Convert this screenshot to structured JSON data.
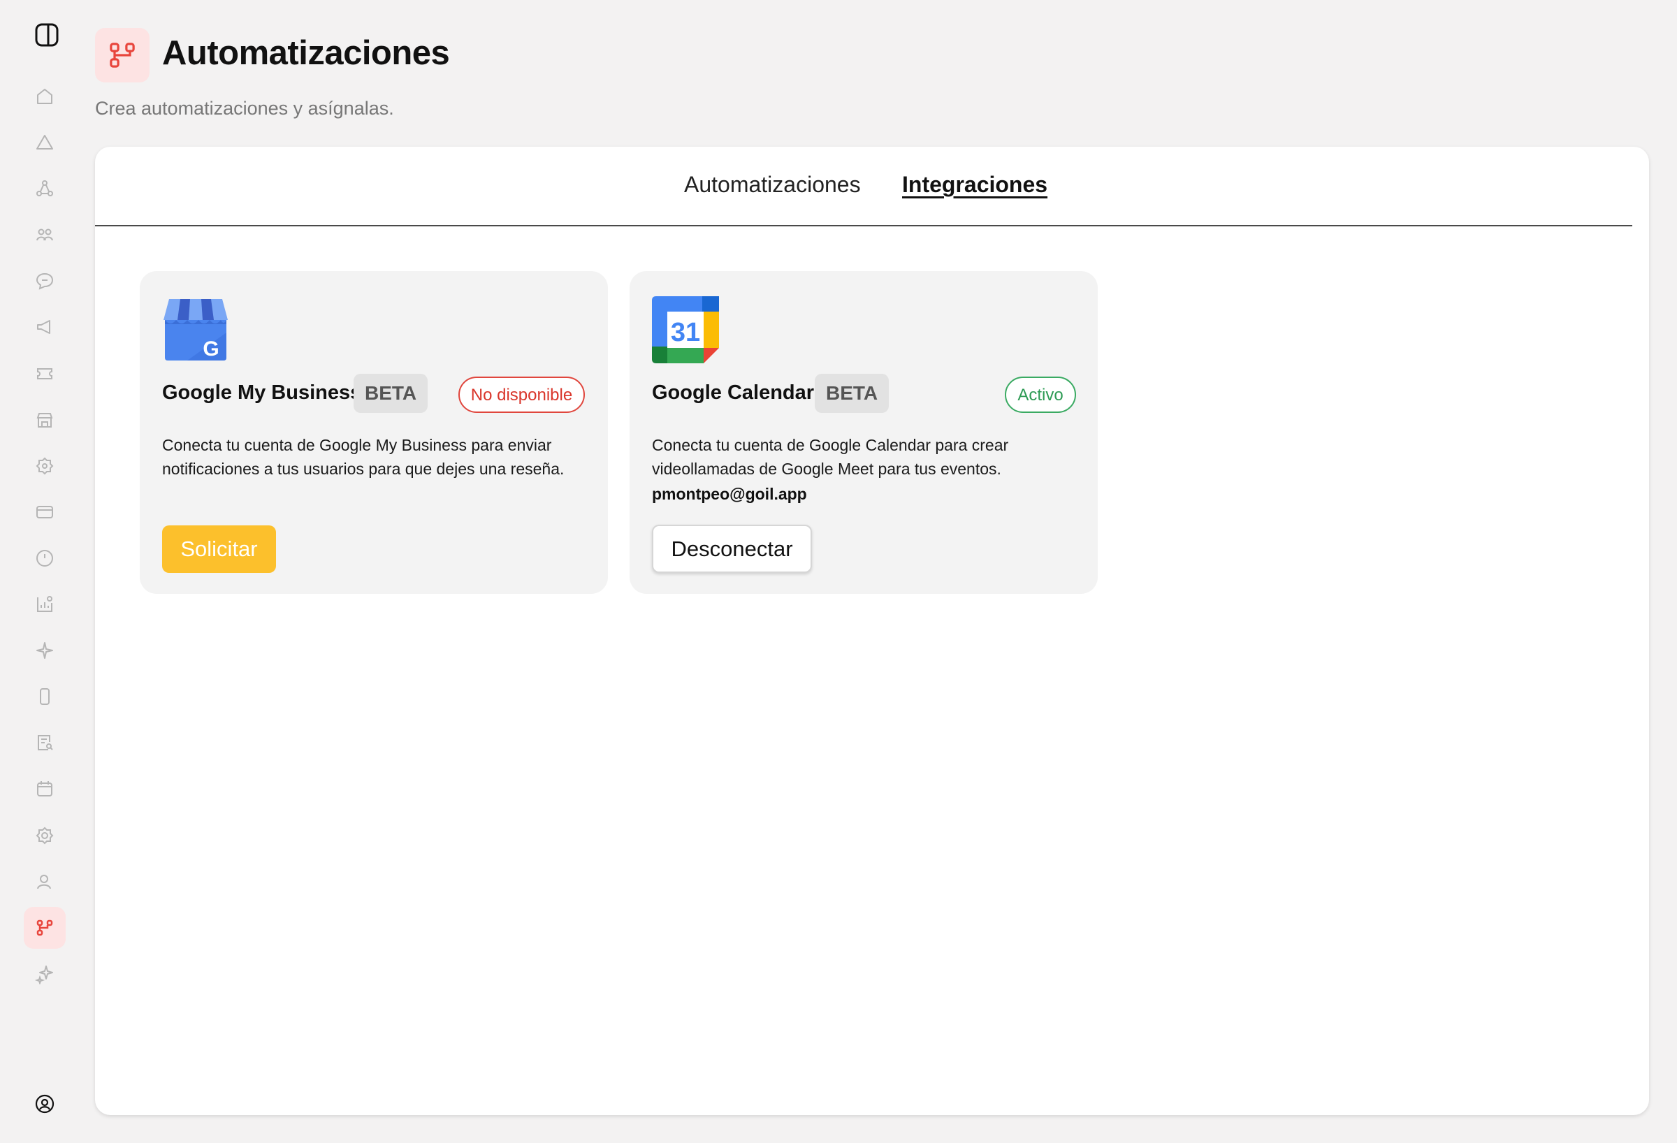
{
  "header": {
    "title": "Automatizaciones",
    "subtitle": "Crea automatizaciones y asígnalas."
  },
  "sidebar": {
    "items": [
      {
        "icon": "home-icon"
      },
      {
        "icon": "alert-triangle-icon"
      },
      {
        "icon": "network-icon"
      },
      {
        "icon": "users-icon"
      },
      {
        "icon": "chat-icon"
      },
      {
        "icon": "megaphone-icon"
      },
      {
        "icon": "ticket-icon"
      },
      {
        "icon": "store-icon"
      },
      {
        "icon": "settings-badge-icon"
      },
      {
        "icon": "card-icon"
      },
      {
        "icon": "clock-icon"
      },
      {
        "icon": "analytics-icon"
      },
      {
        "icon": "sparkle-icon"
      },
      {
        "icon": "phone-icon"
      },
      {
        "icon": "document-search-icon"
      },
      {
        "icon": "calendar-icon"
      },
      {
        "icon": "gear-icon"
      },
      {
        "icon": "user-icon"
      },
      {
        "icon": "automation-icon",
        "active": true
      },
      {
        "icon": "sparkles-icon"
      }
    ]
  },
  "tabs": [
    {
      "label": "Automatizaciones",
      "active": false
    },
    {
      "label": "Integraciones",
      "active": true
    }
  ],
  "integrations": [
    {
      "name": "Google My Business",
      "badge": "BETA",
      "status": "No disponible",
      "description": "Conecta tu cuenta de Google My Business para enviar notificaciones a tus usuarios para que dejes una reseña.",
      "action": "Solicitar",
      "icon": "google-my-business-icon"
    },
    {
      "name": "Google Calendar",
      "badge": "BETA",
      "status": "Activo",
      "description": "Conecta tu cuenta de Google Calendar para crear videollamadas de Google Meet para tus eventos.",
      "email": "pmontpeo@goil.app",
      "action": "Desconectar",
      "icon": "google-calendar-icon",
      "calendar_day": "31"
    }
  ],
  "colors": {
    "accent": "#e8453c",
    "accent_bg": "#fde3e3",
    "solicitar": "#fcc02c",
    "status_unavailable": "#d9362b",
    "status_active": "#2e9b55"
  }
}
